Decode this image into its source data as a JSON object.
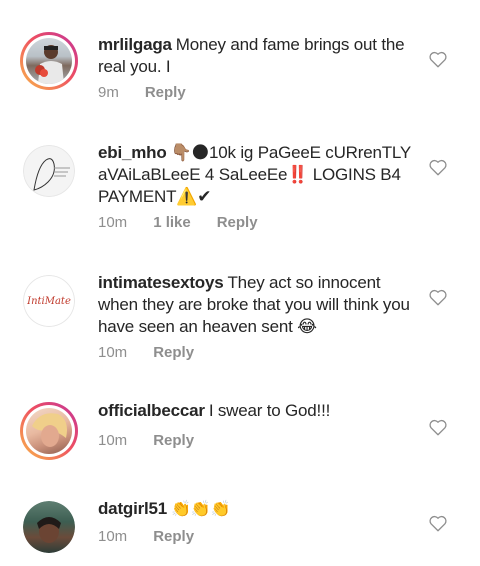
{
  "comments": [
    {
      "username": "mrlilgaga",
      "text": "Money and fame brings out the real you.  I",
      "time": "9m",
      "likes": "",
      "reply": "Reply"
    },
    {
      "username": "ebi_mho",
      "text": "👇🏽🌑10k ig PaGeeE cURrenTLY aVAiLaBLeeE 4 SaLeeEe‼️ LOGINS B4 PAYMENT⚠️✔",
      "time": "10m",
      "likes": "1 like",
      "reply": "Reply"
    },
    {
      "username": "intimatesextoys",
      "text": "They act so innocent when they are broke that you will think you have seen an heaven sent 😂",
      "time": "10m",
      "likes": "",
      "reply": "Reply"
    },
    {
      "username": "officialbeccar",
      "text": "I swear to God!!!",
      "time": "10m",
      "likes": "",
      "reply": "Reply"
    },
    {
      "username": "datgirl51",
      "text": "👏👏👏",
      "time": "10m",
      "likes": "",
      "reply": "Reply"
    }
  ],
  "avatar_logo_text": "IntiMate",
  "icons": {
    "like": "heart-outline-icon"
  },
  "colors": {
    "ring_start": "#f9b84a",
    "ring_end": "#c2349b",
    "muted": "#8e8e8e"
  }
}
